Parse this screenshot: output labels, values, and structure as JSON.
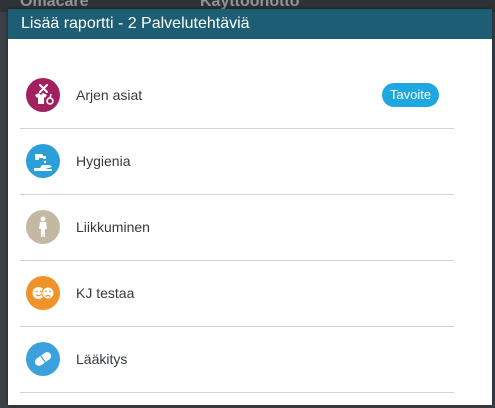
{
  "background": {
    "left_text": "Omacare",
    "right_text": "Kayttoonotto"
  },
  "dialog": {
    "title": "Lisää raportti - 2 Palvelutehtäviä",
    "items": [
      {
        "label": "Arjen asiat",
        "icon": "household-icon",
        "color": "#a3205e",
        "badge": "Tavoite"
      },
      {
        "label": "Hygienia",
        "icon": "washing-hands-icon",
        "color": "#2b9fd8"
      },
      {
        "label": "Liikkuminen",
        "icon": "walking-person-icon",
        "color": "#c4b8a3"
      },
      {
        "label": "KJ testaa",
        "icon": "faces-icon",
        "color": "#f0922a"
      },
      {
        "label": "Lääkitys",
        "icon": "pill-icon",
        "color": "#3aa1dc"
      }
    ]
  },
  "colors": {
    "header_bg": "#1e5e74",
    "badge_bg": "#1fa8e0"
  }
}
